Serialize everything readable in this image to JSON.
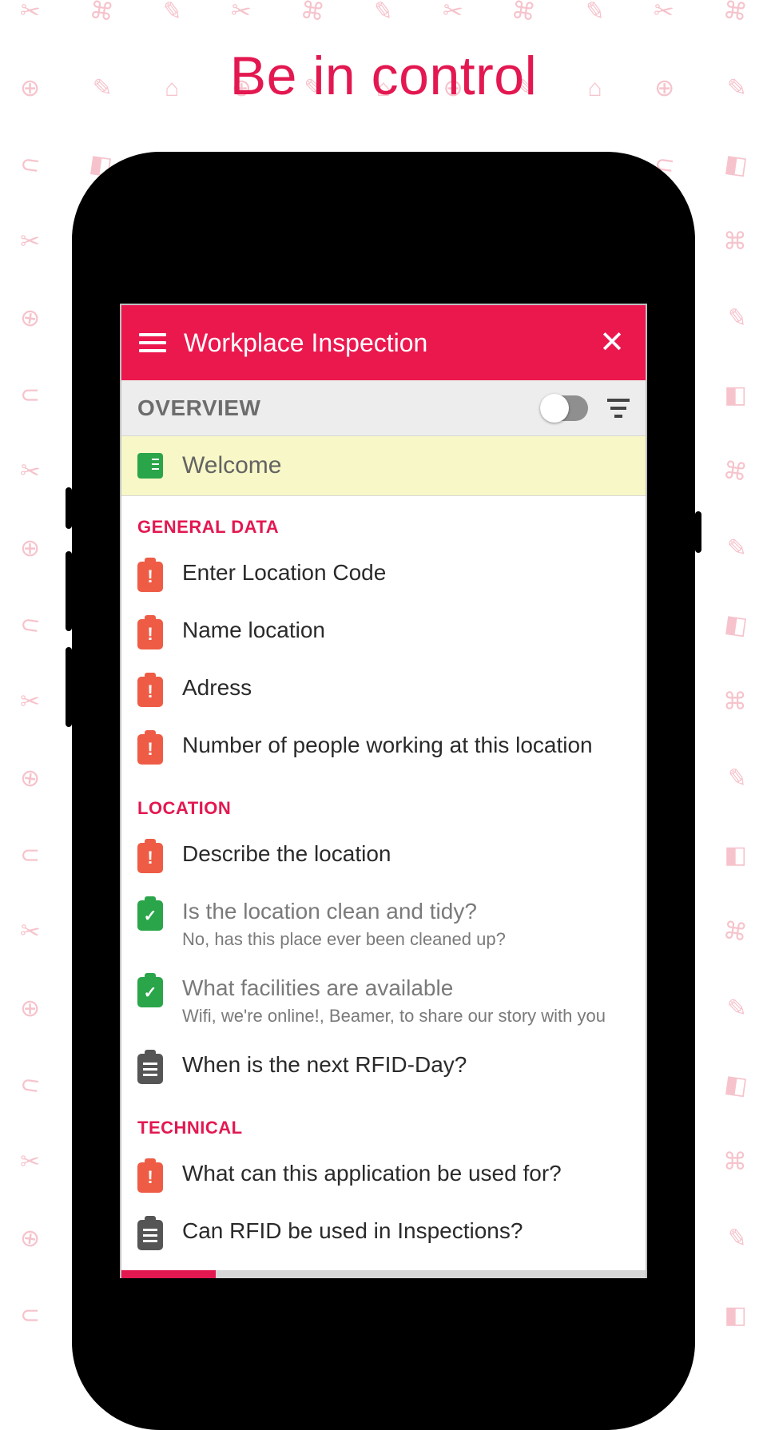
{
  "hero": {
    "title": "Be in control"
  },
  "appbar": {
    "title": "Workplace Inspection"
  },
  "overview": {
    "label": "OVERVIEW",
    "toggle_on": false
  },
  "welcome": {
    "label": "Welcome"
  },
  "sections": [
    {
      "name": "GENERAL DATA",
      "items": [
        {
          "status": "alert",
          "title": "Enter Location Code"
        },
        {
          "status": "alert",
          "title": "Name location"
        },
        {
          "status": "alert",
          "title": "Adress"
        },
        {
          "status": "alert",
          "title": "Number of people working at this location"
        }
      ]
    },
    {
      "name": "LOCATION",
      "items": [
        {
          "status": "alert",
          "title": "Describe the location"
        },
        {
          "status": "done",
          "title": "Is the location clean and tidy?",
          "subtitle": "No, has this place ever been cleaned up?"
        },
        {
          "status": "done",
          "title": "What facilities are available",
          "subtitle": "Wifi, we're online!, Beamer, to share our story with you"
        },
        {
          "status": "plain",
          "title": "When is the next RFID-Day?"
        }
      ]
    },
    {
      "name": "TECHNICAL",
      "items": [
        {
          "status": "alert",
          "title": "What can this application be used for?"
        },
        {
          "status": "plain",
          "title": "Can RFID be used in Inspections?"
        }
      ]
    }
  ],
  "progress_pct": 18
}
